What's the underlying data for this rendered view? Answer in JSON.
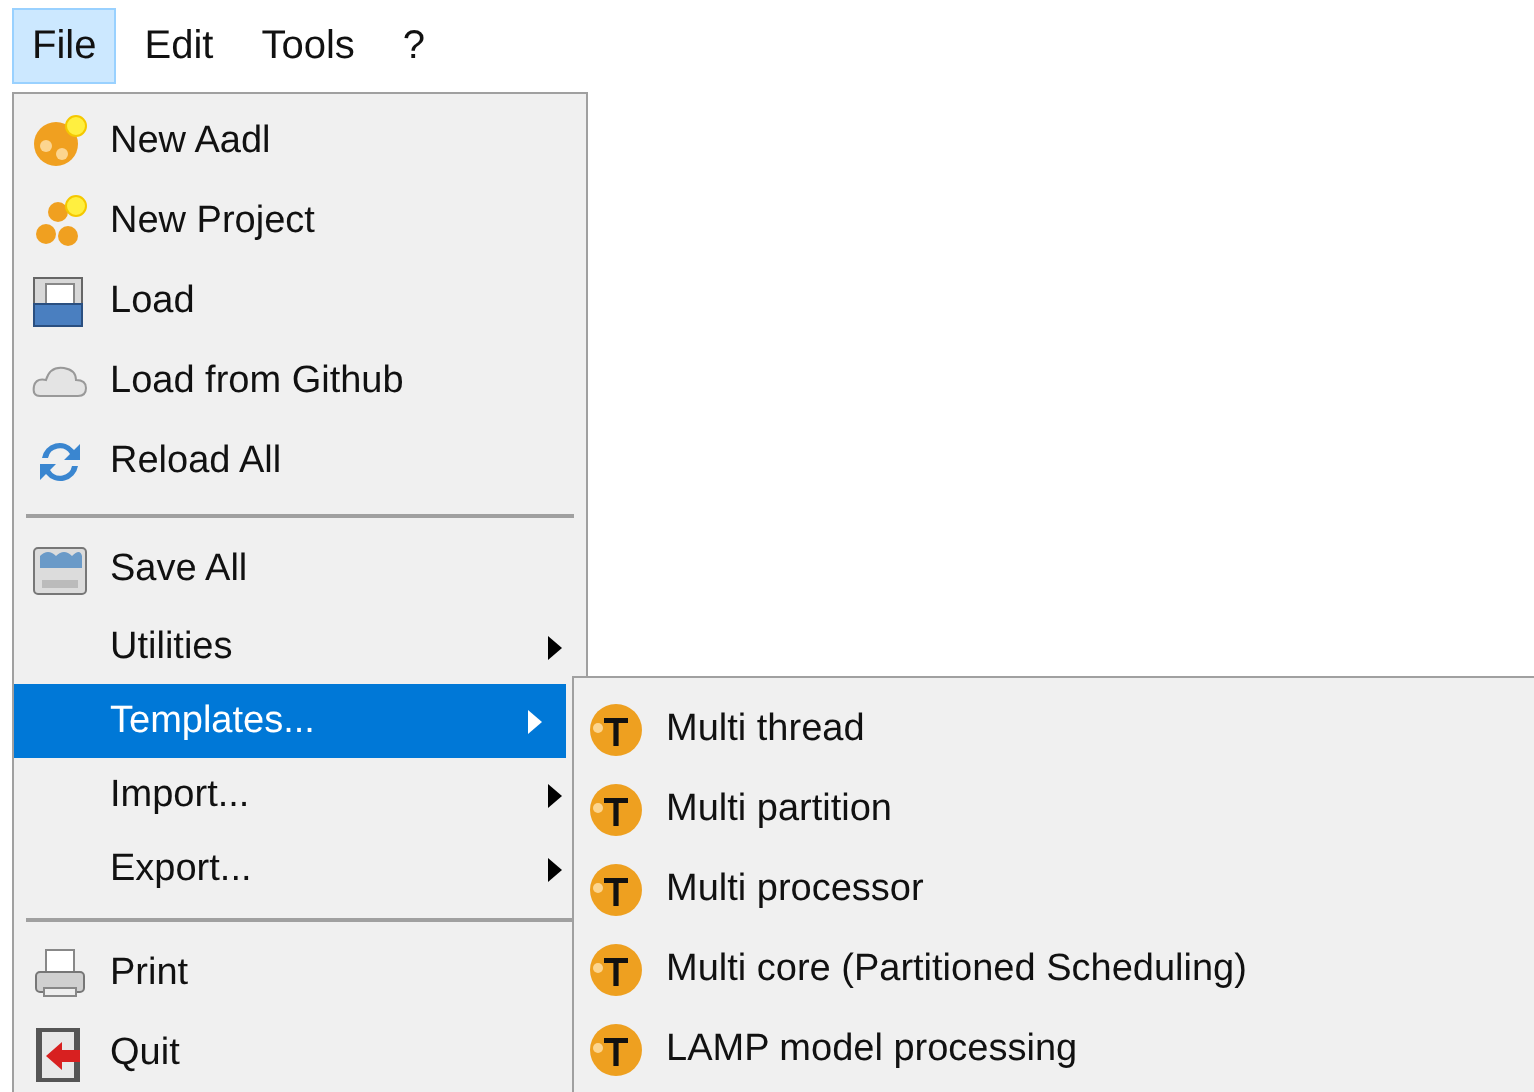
{
  "menubar": [
    {
      "label": "File",
      "selected": true
    },
    {
      "label": "Edit",
      "selected": false
    },
    {
      "label": "Tools",
      "selected": false
    },
    {
      "label": "?",
      "selected": false
    }
  ],
  "file_menu": [
    {
      "kind": "command",
      "label": "New Aadl",
      "selected": false
    },
    {
      "kind": "command",
      "label": "New Project",
      "selected": false
    },
    {
      "kind": "command",
      "label": "Load",
      "selected": false
    },
    {
      "kind": "command",
      "label": "Load from Github",
      "selected": false
    },
    {
      "kind": "command",
      "label": "Reload All",
      "selected": false
    },
    {
      "kind": "separator"
    },
    {
      "kind": "command",
      "label": "Save All",
      "selected": false
    },
    {
      "kind": "submenu",
      "label": "Utilities",
      "selected": false
    },
    {
      "kind": "submenu",
      "label": "Templates...",
      "selected": true
    },
    {
      "kind": "submenu",
      "label": "Import...",
      "selected": false
    },
    {
      "kind": "submenu",
      "label": "Export...",
      "selected": false
    },
    {
      "kind": "separator"
    },
    {
      "kind": "command",
      "label": "Print",
      "selected": false
    },
    {
      "kind": "command",
      "label": "Quit",
      "selected": false
    }
  ],
  "templates_menu": [
    {
      "label": "Multi thread",
      "selected": false
    },
    {
      "label": "Multi partition",
      "selected": false
    },
    {
      "label": "Multi processor",
      "selected": false
    },
    {
      "label": "Multi core (Partitioned Scheduling)",
      "selected": false
    },
    {
      "label": "LAMP model processing",
      "selected": false
    }
  ]
}
